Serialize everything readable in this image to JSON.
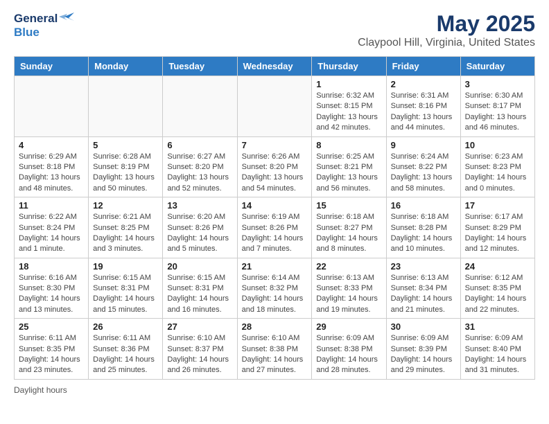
{
  "header": {
    "logo_general": "General",
    "logo_blue": "Blue",
    "title": "May 2025",
    "subtitle": "Claypool Hill, Virginia, United States"
  },
  "days_of_week": [
    "Sunday",
    "Monday",
    "Tuesday",
    "Wednesday",
    "Thursday",
    "Friday",
    "Saturday"
  ],
  "weeks": [
    [
      {
        "day": "",
        "info": ""
      },
      {
        "day": "",
        "info": ""
      },
      {
        "day": "",
        "info": ""
      },
      {
        "day": "",
        "info": ""
      },
      {
        "day": "1",
        "info": "Sunrise: 6:32 AM\nSunset: 8:15 PM\nDaylight: 13 hours\nand 42 minutes."
      },
      {
        "day": "2",
        "info": "Sunrise: 6:31 AM\nSunset: 8:16 PM\nDaylight: 13 hours\nand 44 minutes."
      },
      {
        "day": "3",
        "info": "Sunrise: 6:30 AM\nSunset: 8:17 PM\nDaylight: 13 hours\nand 46 minutes."
      }
    ],
    [
      {
        "day": "4",
        "info": "Sunrise: 6:29 AM\nSunset: 8:18 PM\nDaylight: 13 hours\nand 48 minutes."
      },
      {
        "day": "5",
        "info": "Sunrise: 6:28 AM\nSunset: 8:19 PM\nDaylight: 13 hours\nand 50 minutes."
      },
      {
        "day": "6",
        "info": "Sunrise: 6:27 AM\nSunset: 8:20 PM\nDaylight: 13 hours\nand 52 minutes."
      },
      {
        "day": "7",
        "info": "Sunrise: 6:26 AM\nSunset: 8:20 PM\nDaylight: 13 hours\nand 54 minutes."
      },
      {
        "day": "8",
        "info": "Sunrise: 6:25 AM\nSunset: 8:21 PM\nDaylight: 13 hours\nand 56 minutes."
      },
      {
        "day": "9",
        "info": "Sunrise: 6:24 AM\nSunset: 8:22 PM\nDaylight: 13 hours\nand 58 minutes."
      },
      {
        "day": "10",
        "info": "Sunrise: 6:23 AM\nSunset: 8:23 PM\nDaylight: 14 hours\nand 0 minutes."
      }
    ],
    [
      {
        "day": "11",
        "info": "Sunrise: 6:22 AM\nSunset: 8:24 PM\nDaylight: 14 hours\nand 1 minute."
      },
      {
        "day": "12",
        "info": "Sunrise: 6:21 AM\nSunset: 8:25 PM\nDaylight: 14 hours\nand 3 minutes."
      },
      {
        "day": "13",
        "info": "Sunrise: 6:20 AM\nSunset: 8:26 PM\nDaylight: 14 hours\nand 5 minutes."
      },
      {
        "day": "14",
        "info": "Sunrise: 6:19 AM\nSunset: 8:26 PM\nDaylight: 14 hours\nand 7 minutes."
      },
      {
        "day": "15",
        "info": "Sunrise: 6:18 AM\nSunset: 8:27 PM\nDaylight: 14 hours\nand 8 minutes."
      },
      {
        "day": "16",
        "info": "Sunrise: 6:18 AM\nSunset: 8:28 PM\nDaylight: 14 hours\nand 10 minutes."
      },
      {
        "day": "17",
        "info": "Sunrise: 6:17 AM\nSunset: 8:29 PM\nDaylight: 14 hours\nand 12 minutes."
      }
    ],
    [
      {
        "day": "18",
        "info": "Sunrise: 6:16 AM\nSunset: 8:30 PM\nDaylight: 14 hours\nand 13 minutes."
      },
      {
        "day": "19",
        "info": "Sunrise: 6:15 AM\nSunset: 8:31 PM\nDaylight: 14 hours\nand 15 minutes."
      },
      {
        "day": "20",
        "info": "Sunrise: 6:15 AM\nSunset: 8:31 PM\nDaylight: 14 hours\nand 16 minutes."
      },
      {
        "day": "21",
        "info": "Sunrise: 6:14 AM\nSunset: 8:32 PM\nDaylight: 14 hours\nand 18 minutes."
      },
      {
        "day": "22",
        "info": "Sunrise: 6:13 AM\nSunset: 8:33 PM\nDaylight: 14 hours\nand 19 minutes."
      },
      {
        "day": "23",
        "info": "Sunrise: 6:13 AM\nSunset: 8:34 PM\nDaylight: 14 hours\nand 21 minutes."
      },
      {
        "day": "24",
        "info": "Sunrise: 6:12 AM\nSunset: 8:35 PM\nDaylight: 14 hours\nand 22 minutes."
      }
    ],
    [
      {
        "day": "25",
        "info": "Sunrise: 6:11 AM\nSunset: 8:35 PM\nDaylight: 14 hours\nand 23 minutes."
      },
      {
        "day": "26",
        "info": "Sunrise: 6:11 AM\nSunset: 8:36 PM\nDaylight: 14 hours\nand 25 minutes."
      },
      {
        "day": "27",
        "info": "Sunrise: 6:10 AM\nSunset: 8:37 PM\nDaylight: 14 hours\nand 26 minutes."
      },
      {
        "day": "28",
        "info": "Sunrise: 6:10 AM\nSunset: 8:38 PM\nDaylight: 14 hours\nand 27 minutes."
      },
      {
        "day": "29",
        "info": "Sunrise: 6:09 AM\nSunset: 8:38 PM\nDaylight: 14 hours\nand 28 minutes."
      },
      {
        "day": "30",
        "info": "Sunrise: 6:09 AM\nSunset: 8:39 PM\nDaylight: 14 hours\nand 29 minutes."
      },
      {
        "day": "31",
        "info": "Sunrise: 6:09 AM\nSunset: 8:40 PM\nDaylight: 14 hours\nand 31 minutes."
      }
    ]
  ],
  "footer": {
    "daylight_hours_label": "Daylight hours"
  }
}
